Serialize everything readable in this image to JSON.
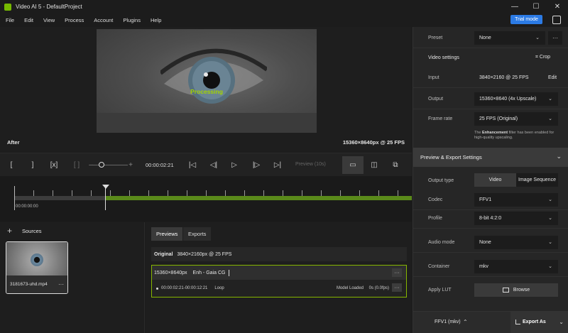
{
  "window": {
    "title": "Video AI 5 - DefaultProject",
    "min": "—",
    "max": "☐",
    "close": "✕"
  },
  "menu": {
    "items": [
      "File",
      "Edit",
      "View",
      "Process",
      "Account",
      "Plugins",
      "Help"
    ],
    "trial": "Trial mode"
  },
  "preview": {
    "processing": "Processing",
    "label_after": "After",
    "resolution": "15360×8640px @ 25 FPS"
  },
  "controls": {
    "timecode": "00:00:02:21",
    "preview_dropdown": "Preview (10s)"
  },
  "timeline": {
    "start_time": "00:00:00:00",
    "playhead_fraction": 0.23
  },
  "sources": {
    "title": "Sources",
    "add": "+",
    "thumb_name": "3181673-uhd.mp4",
    "more": "···"
  },
  "jobs": {
    "tabs": [
      "Previews",
      "Exports"
    ],
    "original_label": "Original",
    "original_spec": "3840×2160px @ 25 FPS",
    "job_res": "15360×8640px",
    "job_model": "Enh - Gaia CG",
    "job_range": "00:00:02:21-00:00:12:21",
    "job_loop": "Loop",
    "job_status": "Model Loaded",
    "job_fps": "0s (0.0fps)",
    "more": "···"
  },
  "panel": {
    "preset_label": "Preset",
    "preset_value": "None",
    "video_settings": "Video settings",
    "crop": "Crop",
    "input_label": "Input",
    "input_value": "3840×2160 @ 25 FPS",
    "edit": "Edit",
    "output_label": "Output",
    "output_value": "15360×8640 (4x Upscale)",
    "framerate_label": "Frame rate",
    "framerate_value": "25 FPS (Original)",
    "note_pre": "The ",
    "note_bold": "Enhancement",
    "note_post": " filter has been enabled for high-quality upscaling.",
    "export_section": "Preview & Export Settings",
    "output_type_label": "Output type",
    "output_type_video": "Video",
    "output_type_seq": "Image Sequence",
    "codec_label": "Codec",
    "codec_value": "FFV1",
    "profile_label": "Profile",
    "profile_value": "8-bit 4:2:0",
    "audio_label": "Audio mode",
    "audio_value": "None",
    "container_label": "Container",
    "container_value": "mkv",
    "lut_label": "Apply LUT",
    "browse": "Browse",
    "export_codec": "FFV1 (mkv)",
    "export_as": "Export As"
  }
}
